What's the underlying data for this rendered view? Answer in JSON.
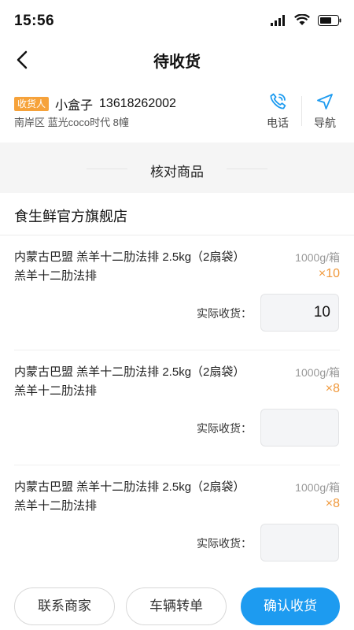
{
  "status_bar": {
    "time": "15:56"
  },
  "header": {
    "title": "待收货"
  },
  "receiver": {
    "tag": "收货人",
    "name": "小盒子",
    "phone": "13618262002",
    "address": "南岸区 蓝光coco时代 8幢",
    "call_label": "电话",
    "nav_label": "导航"
  },
  "section": {
    "title": "核对商品"
  },
  "store": {
    "name": "食生鲜官方旗舰店"
  },
  "products": [
    {
      "name": "内蒙古巴盟 羔羊十二肋法排 2.5kg（2扇袋）羔羊十二肋法排",
      "spec": "1000g/箱",
      "qty": "×10",
      "recv_label": "实际收货：",
      "recv_value": "10"
    },
    {
      "name": "内蒙古巴盟 羔羊十二肋法排 2.5kg（2扇袋）羔羊十二肋法排",
      "spec": "1000g/箱",
      "qty": "×8",
      "recv_label": "实际收货：",
      "recv_value": ""
    },
    {
      "name": "内蒙古巴盟 羔羊十二肋法排 2.5kg（2扇袋）羔羊十二肋法排",
      "spec": "1000g/箱",
      "qty": "×8",
      "recv_label": "实际收货：",
      "recv_value": ""
    }
  ],
  "actions": {
    "contact_merchant": "联系商家",
    "vehicle_transfer": "车辆转单",
    "confirm_receipt": "确认收货"
  },
  "colors": {
    "accent": "#1d9bf0",
    "tag": "#f6a23a",
    "qty": "#f0983a"
  },
  "icons": {
    "back": "chevron-left-icon",
    "call": "phone-icon",
    "navigate": "navigation-arrow-icon"
  }
}
